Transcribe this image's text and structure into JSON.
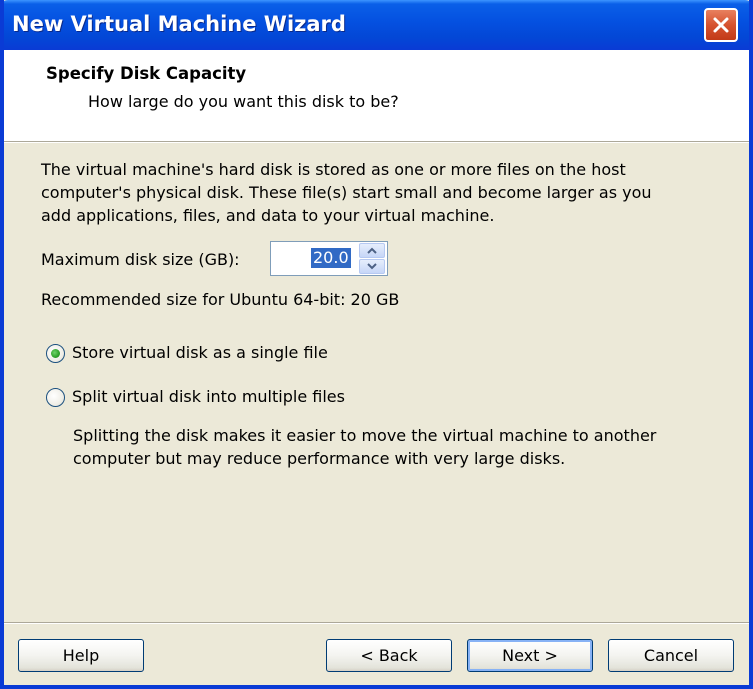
{
  "window": {
    "title": "New Virtual Machine Wizard"
  },
  "header": {
    "title": "Specify Disk Capacity",
    "subtitle": "How large do you want this disk to be?"
  },
  "description": {
    "line1": "The virtual machine's hard disk is stored as one or more files on the host",
    "line2": "computer's physical disk. These file(s) start small and become larger as you",
    "line3": "add applications, files, and data to your virtual machine."
  },
  "disk_size": {
    "label": "Maximum disk size (GB):",
    "value": "20.0"
  },
  "recommendation": "Recommended size for Ubuntu 64-bit: 20 GB",
  "options": {
    "single_file": {
      "label": "Store virtual disk as a single file",
      "selected": true
    },
    "split_files": {
      "label": "Split virtual disk into multiple files",
      "selected": false
    }
  },
  "split_help": {
    "line1": "Splitting the disk makes it easier to move the virtual machine to another",
    "line2": "computer but may reduce performance with very large disks."
  },
  "buttons": {
    "help": "Help",
    "back": "< Back",
    "next": "Next >",
    "cancel": "Cancel"
  },
  "icons": {
    "close": "close-icon",
    "spin_up": "arrow-up-icon",
    "spin_down": "arrow-down-icon"
  },
  "colors": {
    "titlebar": "#0a5fe8",
    "dialog_bg": "#ece9d8",
    "selection": "#316ac5",
    "radio_selected": "#2fa12a"
  }
}
